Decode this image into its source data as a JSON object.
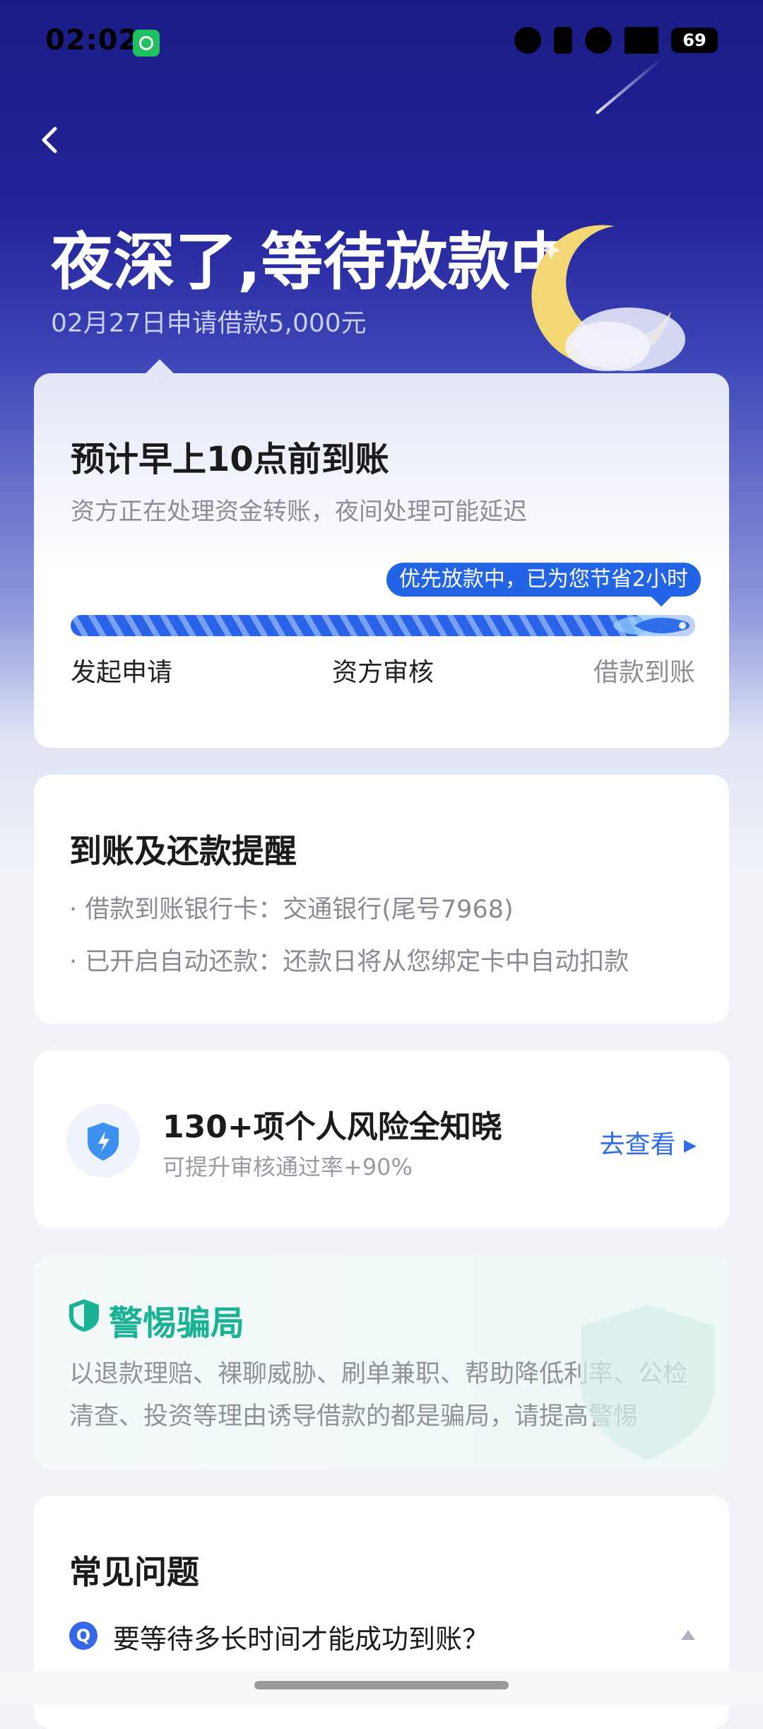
{
  "status_bar": {
    "time": "02:02",
    "battery": "69",
    "icons": [
      "app-notification-icon",
      "alarm-icon",
      "vibrate-icon",
      "location-icon",
      "5g-signal-icon",
      "battery-icon"
    ]
  },
  "header": {
    "title": "夜深了,等待放款中",
    "subtitle": "02月27日申请借款5,000元"
  },
  "progress_card": {
    "title": "预计早上10点前到账",
    "subtitle": "资方正在处理资金转账，夜间处理可能延迟",
    "tip": "优先放款中，已为您节省2小时",
    "progress": 0.92,
    "steps": [
      "发起申请",
      "资方审核",
      "借款到账"
    ]
  },
  "reminder_card": {
    "title": "到账及还款提醒",
    "lines": [
      "· 借款到账银行卡：交通银行(尾号7968)",
      "· 已开启自动还款：还款日将从您绑定卡中自动扣款"
    ]
  },
  "risk_card": {
    "title": "130+项个人风险全知晓",
    "subtitle": "可提升审核通过率+90%",
    "link": "去查看 ▸"
  },
  "fraud_card": {
    "title": "警惕骗局",
    "text": "以退款理赔、裸聊威胁、刷单兼职、帮助降低利率、公检清查、投资等理由诱导借款的都是骗局，请提高警惕"
  },
  "faq_card": {
    "title": "常见问题",
    "badge": "Q",
    "question": "要等待多长时间才能成功到账？"
  },
  "colors": {
    "accent": "#2364e6",
    "header_bg": "#1a1c86",
    "fraud_green": "#19b295"
  }
}
